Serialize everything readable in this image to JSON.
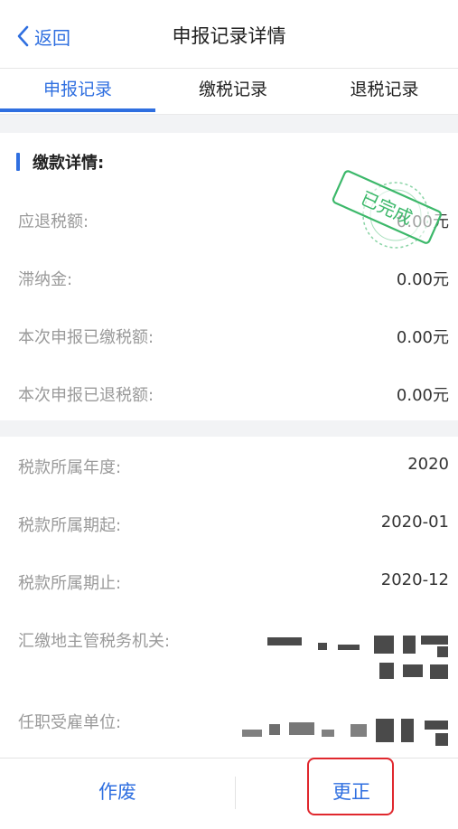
{
  "header": {
    "back_label": "返回",
    "title": "申报记录详情"
  },
  "tabs": [
    {
      "label": "申报记录",
      "active": true
    },
    {
      "label": "缴税记录",
      "active": false
    },
    {
      "label": "退税记录",
      "active": false
    }
  ],
  "payment_section": {
    "title": "缴款详情:",
    "rows": [
      {
        "label": "应退税额:",
        "value": "0.00元"
      },
      {
        "label": "滞纳金:",
        "value": "0.00元"
      },
      {
        "label": "本次申报已缴税额:",
        "value": "0.00元"
      },
      {
        "label": "本次申报已退税额:",
        "value": "0.00元"
      }
    ]
  },
  "stamp": {
    "text": "已完成",
    "color": "#3cb86a"
  },
  "info_section": {
    "rows": [
      {
        "label": "税款所属年度:",
        "value": "2020"
      },
      {
        "label": "税款所属期起:",
        "value": "2020-01"
      },
      {
        "label": "税款所属期止:",
        "value": "2020-12"
      },
      {
        "label": "汇缴地主管税务机关:",
        "value": ""
      },
      {
        "label": "任职受雇单位:",
        "value": ""
      }
    ]
  },
  "footer": {
    "void_label": "作废",
    "correct_label": "更正"
  },
  "colors": {
    "accent": "#2f6fe0",
    "highlight": "#e0282e",
    "background_gap": "#f2f3f5"
  }
}
